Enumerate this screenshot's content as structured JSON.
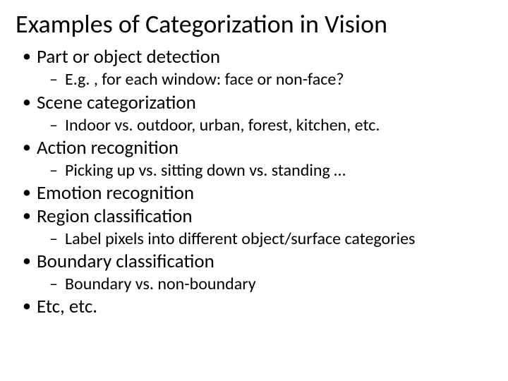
{
  "title": "Examples of Categorization in Vision",
  "b1": {
    "text": "Part or object detection",
    "sub": "E.g. , for each window: face or non-face?"
  },
  "b2": {
    "text": "Scene categorization",
    "sub": "Indoor vs. outdoor, urban, forest, kitchen, etc."
  },
  "b3": {
    "text": "Action recognition",
    "sub": "Picking up vs. sitting down vs. standing …"
  },
  "b4": {
    "text": "Emotion recognition"
  },
  "b5": {
    "text": "Region classification",
    "sub": "Label pixels into different object/surface categories"
  },
  "b6": {
    "text": "Boundary classification",
    "sub": "Boundary vs. non-boundary"
  },
  "b7": {
    "text": "Etc, etc."
  }
}
